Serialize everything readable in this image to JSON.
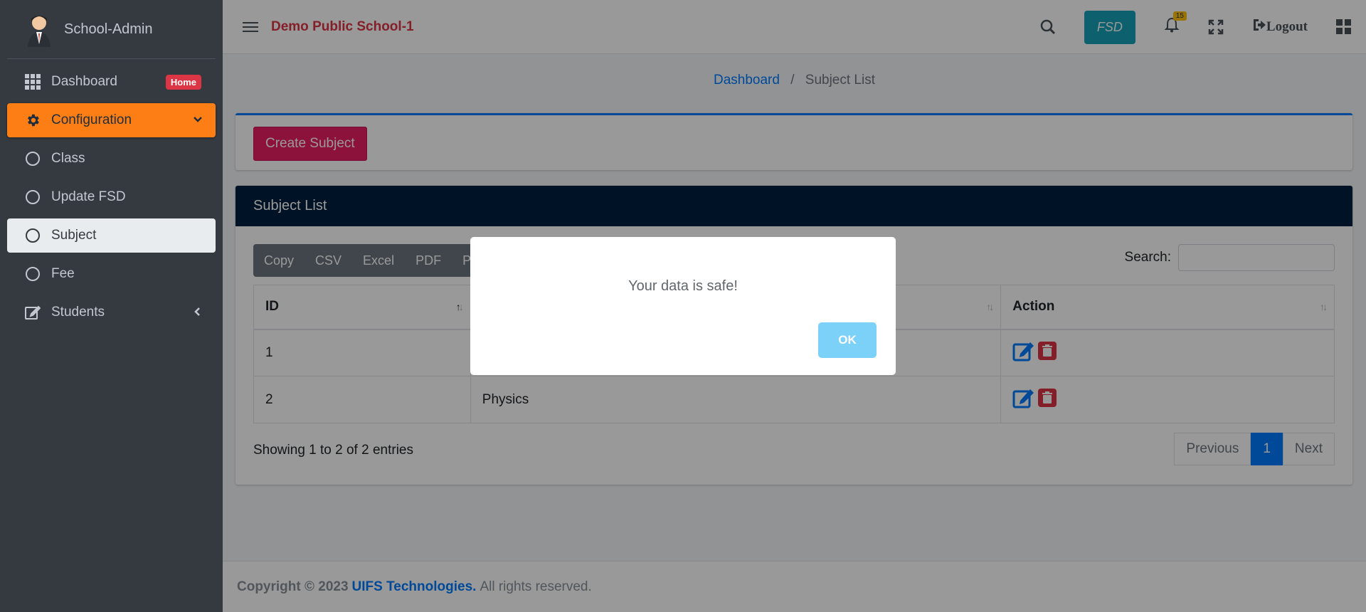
{
  "brand": {
    "title": "School-Admin",
    "avatar_icon": "user-avatar-icon"
  },
  "sidebar": {
    "items": [
      {
        "label": "Dashboard",
        "icon": "grid-icon",
        "badge": "Home"
      },
      {
        "label": "Configuration",
        "icon": "gear-icon"
      },
      {
        "label": "Class",
        "icon": "circle-icon"
      },
      {
        "label": "Update FSD",
        "icon": "circle-icon"
      },
      {
        "label": "Subject",
        "icon": "circle-icon"
      },
      {
        "label": "Fee",
        "icon": "circle-icon"
      },
      {
        "label": "Students",
        "icon": "edit-icon"
      }
    ]
  },
  "header": {
    "school_name": "Demo Public School-1",
    "fsd_label": "FSD",
    "notification_count": "15",
    "logout_label": "Logout"
  },
  "breadcrumb": {
    "home": "Dashboard",
    "current": "Subject List"
  },
  "toolbar": {
    "create_label": "Create Subject"
  },
  "list": {
    "title": "Subject List",
    "buttons": [
      "Copy",
      "CSV",
      "Excel",
      "PDF",
      "Pr"
    ],
    "search_label": "Search:",
    "columns": [
      "ID",
      "",
      "Action"
    ],
    "rows": [
      {
        "id": "1",
        "name": ""
      },
      {
        "id": "2",
        "name": "Physics"
      }
    ],
    "showing": "Showing 1 to 2 of 2 entries",
    "pager": {
      "prev": "Previous",
      "current": "1",
      "next": "Next"
    }
  },
  "footer": {
    "prefix": "Copyright © 2023",
    "company": "UIFS Technologies.",
    "suffix": "All rights reserved."
  },
  "modal": {
    "message": "Your data is safe!",
    "ok_label": "OK"
  },
  "colors": {
    "accent": "#fd7e14",
    "danger": "#dc3545",
    "primary": "#007bff",
    "navy": "#001f3f",
    "pink": "#e91e63"
  }
}
